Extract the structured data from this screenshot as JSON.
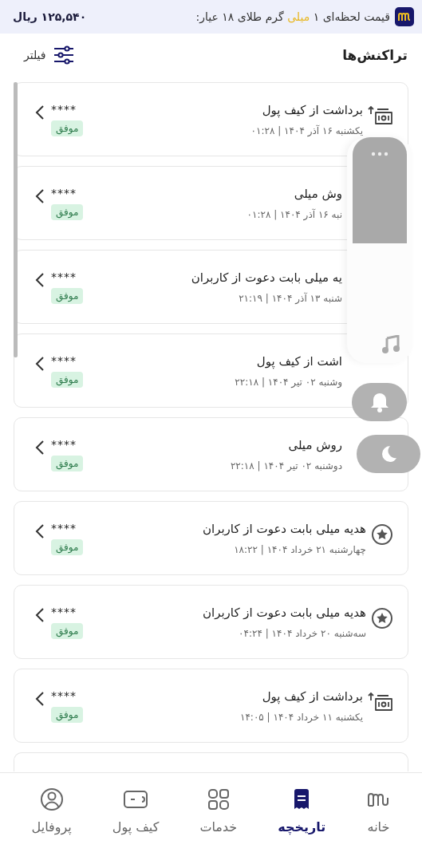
{
  "price_bar": {
    "parts": [
      {
        "text": "قیمت لحظه‌ای ۱",
        "highlight": false
      },
      {
        "text": "میلی",
        "highlight": true
      },
      {
        "text": "گرم طلای ۱۸ عیار:",
        "highlight": false
      }
    ],
    "price": "۱۲۵,۵۴۰ ریال"
  },
  "header": {
    "title": "تراکنش‌ها",
    "filter": "فیلتر"
  },
  "transactions": [
    {
      "kind": "withdraw",
      "title": "برداشت از کیف پول",
      "date": "یکشنبه ۱۶ آذر ۱۴۰۴ | ۰۱:۲۸",
      "amount": "****",
      "status": "موفق"
    },
    {
      "kind": "covered",
      "title": "وش میلی",
      "date": "نبه ۱۶ آذر ۱۴۰۴ | ۰۱:۲۸",
      "amount": "****",
      "status": "موفق"
    },
    {
      "kind": "covered",
      "title": "یه میلی بابت دعوت از کاربران",
      "date": "شنبه ۱۳ آذر ۱۴۰۴ | ۲۱:۱۹",
      "amount": "****",
      "status": "موفق"
    },
    {
      "kind": "covered",
      "title": "اشت از کیف پول",
      "date": "وشنبه ۰۲ تیر ۱۴۰۴ | ۲۲:۱۸",
      "amount": "****",
      "status": "موفق"
    },
    {
      "kind": "covered",
      "title": "روش میلی",
      "date": "دوشنبه ۰۲ تیر ۱۴۰۴ | ۲۲:۱۸",
      "amount": "****",
      "status": "موفق"
    },
    {
      "kind": "gift",
      "title": "هدیه میلی بابت دعوت از کاربران",
      "date": "چهارشنبه ۲۱ خرداد ۱۴۰۴ | ۱۸:۲۲",
      "amount": "****",
      "status": "موفق"
    },
    {
      "kind": "gift",
      "title": "هدیه میلی بابت دعوت از کاربران",
      "date": "سه‌شنبه ۲۰ خرداد ۱۴۰۴ | ۰۴:۲۴",
      "amount": "****",
      "status": "موفق"
    },
    {
      "kind": "withdraw",
      "title": "برداشت از کیف پول",
      "date": "یکشنبه ۱۱ خرداد ۱۴۰۴ | ۱۴:۰۵",
      "amount": "****",
      "status": "موفق"
    }
  ],
  "nav": [
    {
      "label": "خانه",
      "selected": false
    },
    {
      "label": "تاریخچه",
      "selected": true
    },
    {
      "label": "خدمات",
      "selected": false
    },
    {
      "label": "کیف پول",
      "selected": false
    },
    {
      "label": "پروفایل",
      "selected": false
    }
  ]
}
